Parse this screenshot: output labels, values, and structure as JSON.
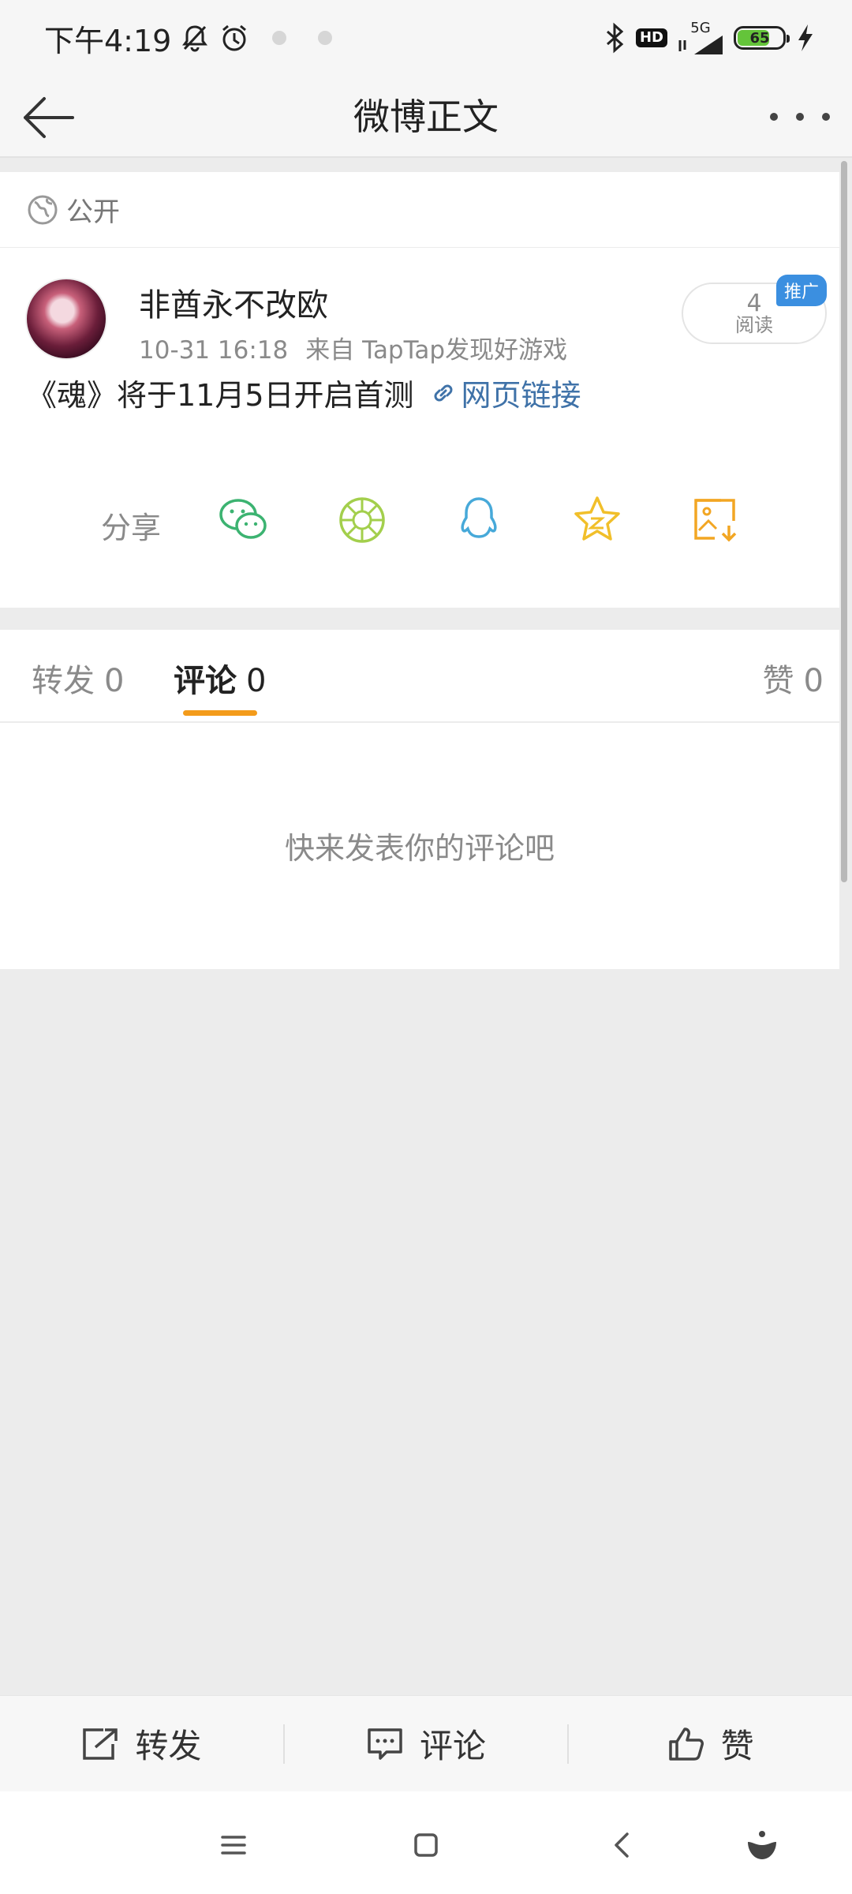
{
  "status_bar": {
    "time": "下午4:19",
    "icons": [
      "bell-off-icon",
      "alarm-icon",
      "bluetooth-icon",
      "hd-icon",
      "signal-5g-icon",
      "battery-icon",
      "charging-icon"
    ],
    "hd": "HD",
    "network": "5G",
    "battery": "65"
  },
  "nav": {
    "title": "微博正文",
    "back_icon": "arrow-left-icon",
    "more_icon": "more-dots-icon"
  },
  "post": {
    "visibility": "公开",
    "author": "非酋永不改欧",
    "date": "10-31 16:18",
    "source": "来自 TapTap发现好游戏",
    "reads_count": "4",
    "reads_label": "阅读",
    "promo_badge": "推广",
    "text": "《魂》将于11月5日开启首测",
    "link_text": "网页链接"
  },
  "share": {
    "label": "分享",
    "targets": [
      {
        "name": "wechat",
        "icon": "wechat-icon",
        "color": "#3cb371"
      },
      {
        "name": "moments",
        "icon": "moments-icon",
        "color": "#a3cf4c"
      },
      {
        "name": "qq",
        "icon": "qq-icon",
        "color": "#47a9d9"
      },
      {
        "name": "favorite",
        "icon": "star-icon",
        "color": "#f1bf2a"
      },
      {
        "name": "save-image",
        "icon": "image-download-icon",
        "color": "#f2a623"
      }
    ]
  },
  "tabs": {
    "repost_label": "转发",
    "repost_count": "0",
    "comment_label": "评论",
    "comment_count": "0",
    "like_label": "赞",
    "like_count": "0",
    "active": "comment",
    "accent": "#f39b1b"
  },
  "empty_tip": "快来发表你的评论吧",
  "actions": {
    "repost": "转发",
    "comment": "评论",
    "like": "赞"
  },
  "system_nav": [
    "menu-icon",
    "home-icon",
    "back-icon",
    "assistant-icon"
  ]
}
